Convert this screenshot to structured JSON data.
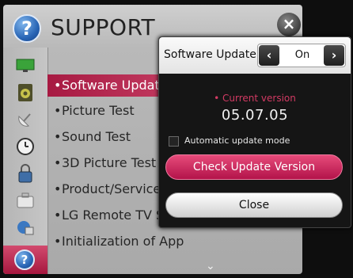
{
  "header": {
    "title": "SUPPORT",
    "help_icon": "?",
    "close_icon": "×"
  },
  "sidebar": {
    "icons": [
      "tv-icon",
      "speaker-icon",
      "satellite-icon",
      "clock-icon",
      "lock-icon",
      "toolbox-icon",
      "network-icon",
      "support-icon"
    ],
    "active": "support-icon"
  },
  "menu": {
    "items": [
      "Software Update",
      "Picture Test",
      "Sound Test",
      "3D Picture Test",
      "Product/Service In",
      "LG Remote TV Serv",
      "Initialization of App"
    ],
    "selected_index": 0,
    "more_indicator": "⌄"
  },
  "popup": {
    "title": "Software Update",
    "toggle_value": "On",
    "prev_arrow": "‹",
    "next_arrow": "›",
    "current_version_label": "• Current version",
    "current_version": "05.07.05",
    "auto_update_label": "Automatic update mode",
    "auto_update_checked": false,
    "check_button": "Check Update Version",
    "close_button": "Close"
  },
  "colors": {
    "accent": "#b3134a",
    "panel": "#b9b9b9",
    "background": "#0e0e0e"
  }
}
